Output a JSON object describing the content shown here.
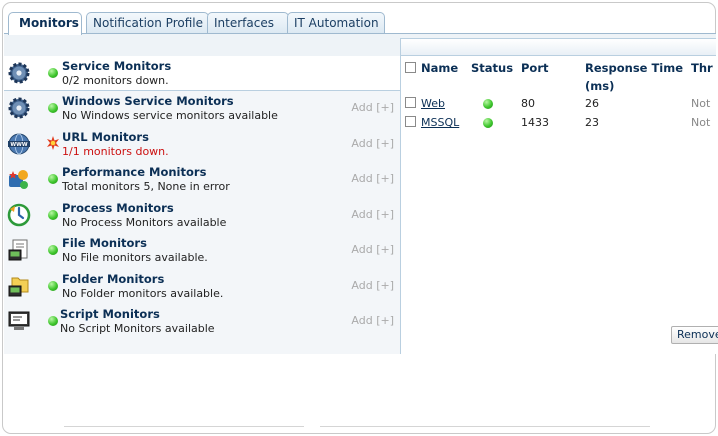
{
  "tabs": [
    {
      "label": "Monitors",
      "active": true
    },
    {
      "label": "Notification Profile",
      "active": false
    },
    {
      "label": "Interfaces",
      "active": false
    },
    {
      "label": "IT Automation",
      "active": false
    }
  ],
  "monitors": [
    {
      "title": "Service Monitors",
      "status": "0/2 monitors down.",
      "icon": "gear-icon",
      "error": false,
      "add": ""
    },
    {
      "title": "Windows Service Monitors",
      "status": "No Windows service monitors available",
      "icon": "gear-icon",
      "error": false,
      "add": "Add [+]"
    },
    {
      "title": "URL Monitors",
      "status": "1/1 monitors down.",
      "icon": "www-globe-icon",
      "error": true,
      "add": "Add [+]"
    },
    {
      "title": "Performance Monitors",
      "status": "Total monitors 5, None in error",
      "icon": "performance-icon",
      "error": false,
      "add": "Add [+]"
    },
    {
      "title": "Process Monitors",
      "status": "No Process Monitors available",
      "icon": "process-icon",
      "error": false,
      "add": "Add [+]"
    },
    {
      "title": "File Monitors",
      "status": "No File monitors available.",
      "icon": "file-icon",
      "error": false,
      "add": "Add [+]"
    },
    {
      "title": "Folder Monitors",
      "status": "No Folder monitors available.",
      "icon": "folder-icon",
      "error": false,
      "add": "Add [+]"
    },
    {
      "title": "Script Monitors",
      "status": "No Script Monitors available",
      "icon": "script-icon",
      "error": false,
      "add": "Add [+]"
    }
  ],
  "service_table": {
    "headers": {
      "name": "Name",
      "status": "Status",
      "port": "Port",
      "response_line1": "Response Time",
      "response_line2": "(ms)",
      "threshold": "Thr"
    },
    "rows": [
      {
        "name": "Web",
        "port": "80",
        "response": "26",
        "threshold": "Not"
      },
      {
        "name": "MSSQL",
        "port": "1433",
        "response": "23",
        "threshold": "Not"
      }
    ],
    "remove_label": "Remove"
  },
  "colors": {
    "accent": "#0b2f55",
    "up": "#3fc62d",
    "error": "#cc1111"
  }
}
